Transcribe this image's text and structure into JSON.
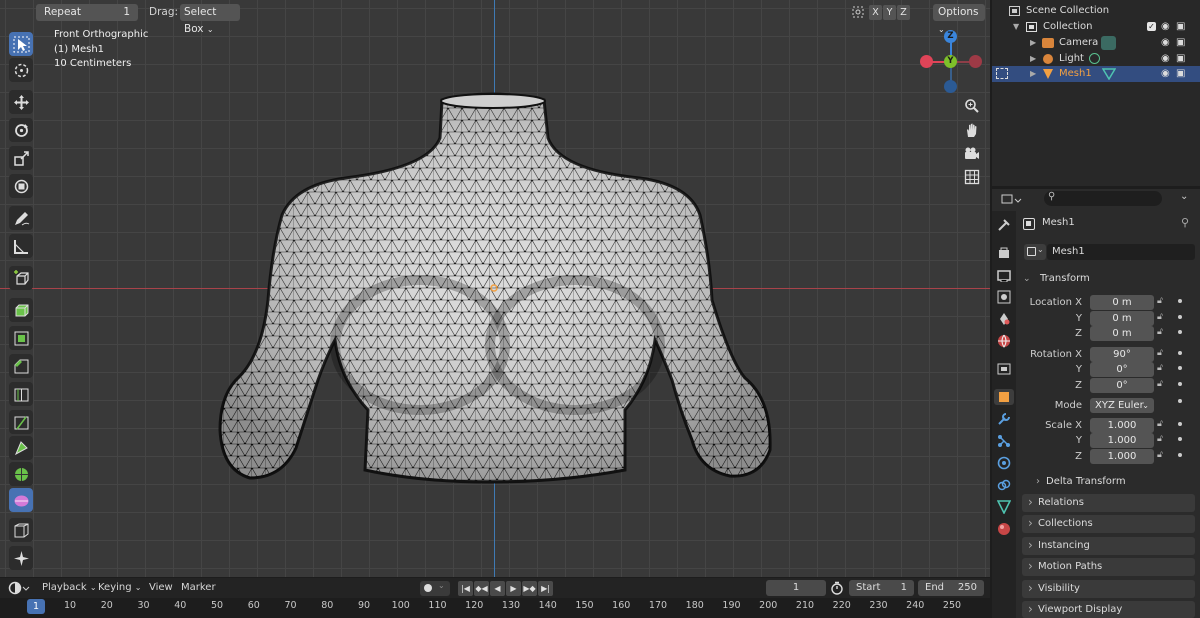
{
  "viewport_header": {
    "repeat_label": "Repeat",
    "repeat_value": "1",
    "drag_label": "Drag:",
    "drag_value": "Select Box",
    "axis_x": "X",
    "axis_y": "Y",
    "axis_z": "Z",
    "options_label": "Options"
  },
  "viewport_overlay": {
    "view_name": "Front Orthographic",
    "object_name": "(1) Mesh1",
    "scale": "10 Centimeters"
  },
  "gizmo": {
    "z": "Z",
    "y": "Y",
    "x": "X"
  },
  "outliner": {
    "root": "Scene Collection",
    "collection": "Collection",
    "items": [
      {
        "label": "Camera"
      },
      {
        "label": "Light"
      },
      {
        "label": "Mesh1"
      }
    ]
  },
  "properties": {
    "search_placeholder": "",
    "object_name": "Mesh1",
    "object_field": "Mesh1",
    "transform_title": "Transform",
    "location_label": "Location X",
    "rotation_label": "Rotation X",
    "scale_label": "Scale X",
    "y_label": "Y",
    "z_label": "Z",
    "location": [
      "0 m",
      "0 m",
      "0 m"
    ],
    "rotation": [
      "90°",
      "0°",
      "0°"
    ],
    "mode_label": "Mode",
    "mode_value": "XYZ Euler",
    "scale": [
      "1.000",
      "1.000",
      "1.000"
    ],
    "delta_transform": "Delta Transform",
    "panels": [
      "Relations",
      "Collections",
      "Instancing",
      "Motion Paths",
      "Visibility",
      "Viewport Display"
    ]
  },
  "timeline": {
    "playback": "Playback",
    "keying": "Keying",
    "view": "View",
    "marker": "Marker",
    "current_frame": "1",
    "start_label": "Start",
    "start_value": "1",
    "end_label": "End",
    "end_value": "250",
    "ruler_current": "1",
    "ticks": [
      "10",
      "20",
      "30",
      "40",
      "50",
      "60",
      "70",
      "80",
      "90",
      "100",
      "110",
      "120",
      "130",
      "140",
      "150",
      "160",
      "170",
      "180",
      "190",
      "200",
      "210",
      "220",
      "230",
      "240",
      "250"
    ]
  },
  "colors": {
    "accent": "#4772b3",
    "x_axis": "#e04458",
    "y_axis": "#7ec02a",
    "z_axis": "#3a85dc",
    "selected_object": "#f2a042"
  }
}
